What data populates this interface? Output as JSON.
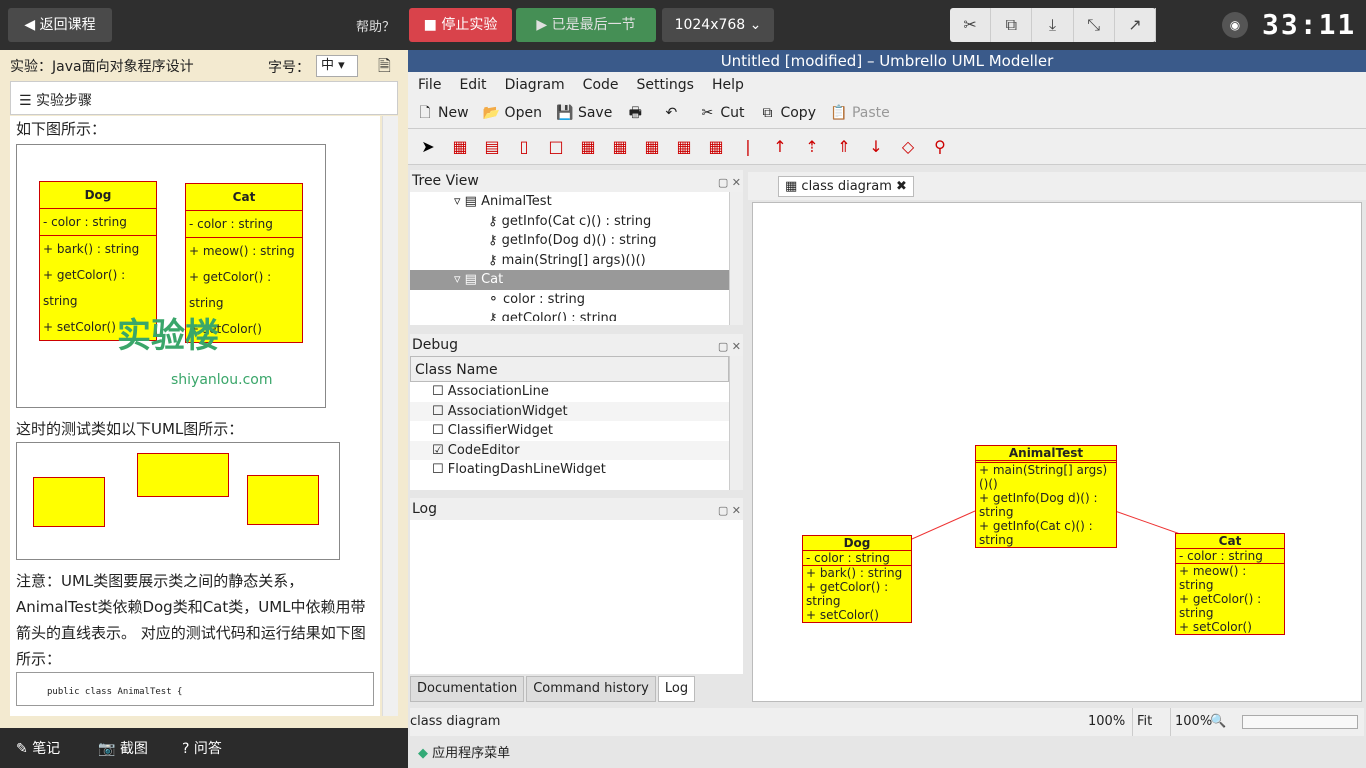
{
  "topbar": {
    "back": "返回课程",
    "help": "帮助？",
    "stop": "停止实验",
    "last": "已是最后一节",
    "resolution": "1024x768",
    "timer": "33:11"
  },
  "left": {
    "lab": "实验：Java面向对象程序设计",
    "font_label": "字号：",
    "font_value": "中",
    "steps": "实验步骤",
    "text1": "如下图所示：",
    "text2": "这时的测试类如以下UML图所示：",
    "text3": "注意：UML类图要展示类之间的静态关系，AnimalTest类依赖Dog类和Cat类，UML中依赖用带箭头的直线表示。 对应的测试代码和运行结果如下图所示：",
    "code_line": "public class AnimalTest {",
    "watermark": "实验楼",
    "watermark_url": "shiyanlou.com",
    "dog": {
      "name": "Dog",
      "attr": "- color : string",
      "ops": [
        "+ bark() : string",
        "+ getColor() : string",
        "+ setColor()"
      ]
    },
    "cat": {
      "name": "Cat",
      "attr": "- color : string",
      "ops": [
        "+ meow() : string",
        "+ getColor() : string",
        "+ setColor()"
      ]
    }
  },
  "bottombar": {
    "notes": "笔记",
    "screenshot": "截图",
    "qa": "问答"
  },
  "app": {
    "title": "Untitled [modified] – Umbrello UML Modeller",
    "menu": [
      "File",
      "Edit",
      "Diagram",
      "Code",
      "Settings",
      "Help"
    ],
    "toolbar": [
      "New",
      "Open",
      "Save",
      "Cut",
      "Copy",
      "Paste"
    ],
    "tree_title": "Tree View",
    "tree": [
      "AnimalTest",
      "getInfo(Cat c)() : string",
      "getInfo(Dog d)() : string",
      "main(String[] args)()()",
      "Cat",
      "color : string",
      "getColor() : string"
    ],
    "debug_title": "Debug",
    "debug_col": "Class Name",
    "debug_items": [
      "AssociationLine",
      "AssociationWidget",
      "ClassifierWidget",
      "CodeEditor",
      "FloatingDashLineWidget"
    ],
    "log_title": "Log",
    "tabs": [
      "Documentation",
      "Command history",
      "Log"
    ],
    "diagram_tab": "class diagram",
    "status": "class diagram",
    "zoom1": "100%",
    "fit": "Fit",
    "zoom2": "100%",
    "taskbar": "应用程序菜单",
    "animal": {
      "name": "AnimalTest",
      "ops": [
        "+ main(String[] args)()()",
        "+ getInfo(Dog d)() : string",
        "+ getInfo(Cat c)() : string"
      ]
    }
  }
}
